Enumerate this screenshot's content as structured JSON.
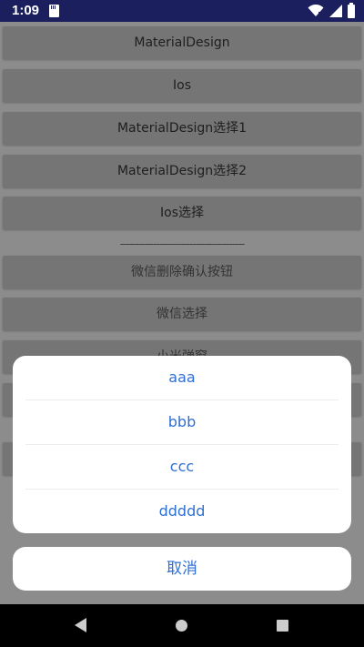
{
  "status_bar": {
    "time": "1:09",
    "icons": [
      "sd-card-icon",
      "wifi-icon",
      "signal-icon",
      "battery-icon"
    ]
  },
  "buttons": [
    {
      "label": "MaterialDesign"
    },
    {
      "label": "Ios"
    },
    {
      "label": "MaterialDesign选择1"
    },
    {
      "label": "MaterialDesign选择2"
    },
    {
      "label": "Ios选择"
    }
  ],
  "divider": "-----------------------------------------",
  "buttons2": [
    {
      "label": "微信删除确认按钮"
    },
    {
      "label": "微信选择"
    },
    {
      "label": "小米弹窗"
    }
  ],
  "action_sheet": {
    "items": [
      "aaa",
      "bbb",
      "ccc",
      "ddddd"
    ],
    "cancel": "取消",
    "accent_color": "#2f6fd3"
  },
  "nav_bar": {
    "icons": [
      "back-icon",
      "home-icon",
      "recents-icon"
    ]
  }
}
